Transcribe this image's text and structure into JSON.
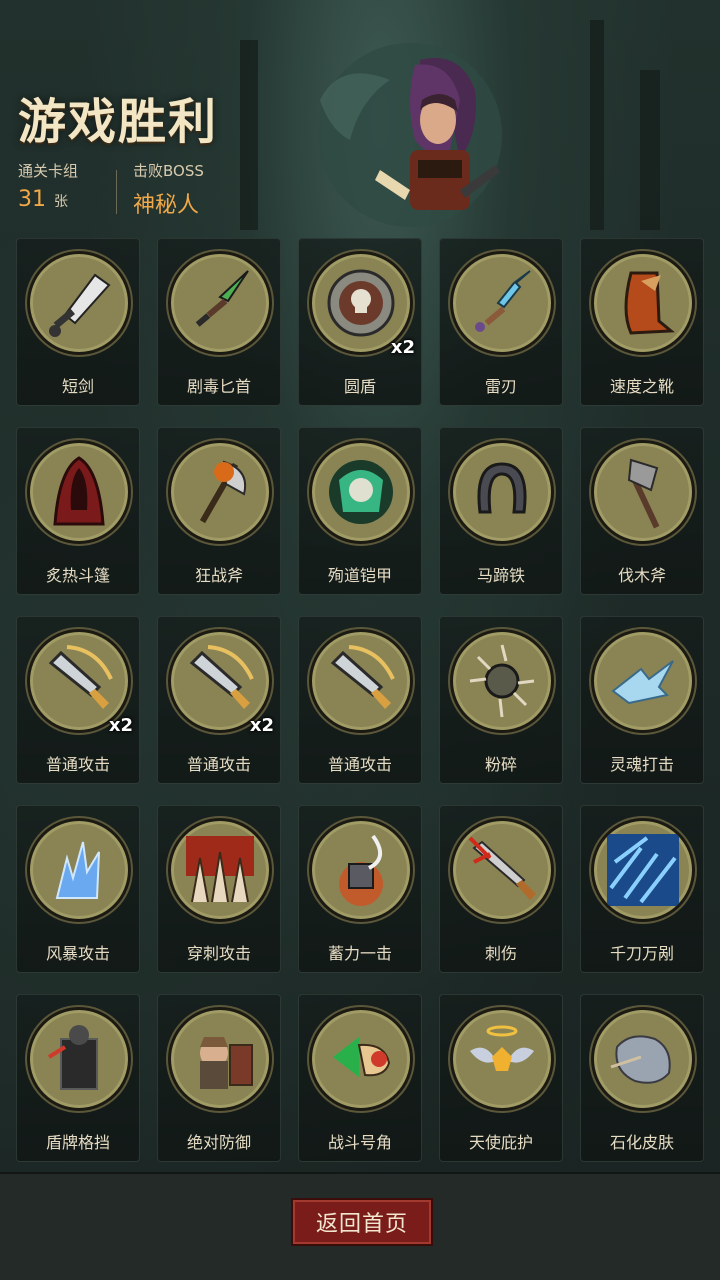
{
  "title": "游戏胜利",
  "stats": {
    "deck_label": "通关卡组",
    "deck_count": "31",
    "deck_unit": "张",
    "boss_label": "击败BOSS",
    "boss_name": "神秘人"
  },
  "cards": [
    {
      "name": "短剑",
      "icon": "short-sword-icon",
      "count": ""
    },
    {
      "name": "剧毒匕首",
      "icon": "poison-dagger-icon",
      "count": ""
    },
    {
      "name": "圆盾",
      "icon": "round-shield-icon",
      "count": "x2"
    },
    {
      "name": "雷刃",
      "icon": "thunder-blade-icon",
      "count": ""
    },
    {
      "name": "速度之靴",
      "icon": "speed-boots-icon",
      "count": ""
    },
    {
      "name": "炙热斗篷",
      "icon": "cloak-icon",
      "count": ""
    },
    {
      "name": "狂战斧",
      "icon": "berserker-axe-icon",
      "count": ""
    },
    {
      "name": "殉道铠甲",
      "icon": "martyr-armor-icon",
      "count": ""
    },
    {
      "name": "马蹄铁",
      "icon": "horseshoe-icon",
      "count": ""
    },
    {
      "name": "伐木斧",
      "icon": "wood-axe-icon",
      "count": ""
    },
    {
      "name": "普通攻击",
      "icon": "basic-attack-icon",
      "count": "x2"
    },
    {
      "name": "普通攻击",
      "icon": "basic-attack-icon",
      "count": "x2"
    },
    {
      "name": "普通攻击",
      "icon": "basic-attack-icon",
      "count": ""
    },
    {
      "name": "粉碎",
      "icon": "shatter-icon",
      "count": ""
    },
    {
      "name": "灵魂打击",
      "icon": "soul-strike-icon",
      "count": ""
    },
    {
      "name": "风暴攻击",
      "icon": "storm-attack-icon",
      "count": ""
    },
    {
      "name": "穿刺攻击",
      "icon": "pierce-attack-icon",
      "count": ""
    },
    {
      "name": "蓄力一击",
      "icon": "charged-strike-icon",
      "count": ""
    },
    {
      "name": "刺伤",
      "icon": "stab-icon",
      "count": ""
    },
    {
      "name": "千刀万剐",
      "icon": "thousand-cuts-icon",
      "count": ""
    },
    {
      "name": "盾牌格挡",
      "icon": "shield-block-icon",
      "count": ""
    },
    {
      "name": "绝对防御",
      "icon": "absolute-defense-icon",
      "count": ""
    },
    {
      "name": "战斗号角",
      "icon": "war-horn-icon",
      "count": ""
    },
    {
      "name": "天使庇护",
      "icon": "angel-protection-icon",
      "count": ""
    },
    {
      "name": "石化皮肤",
      "icon": "stone-skin-icon",
      "count": ""
    }
  ],
  "footer": {
    "home_label": "返回首页"
  }
}
